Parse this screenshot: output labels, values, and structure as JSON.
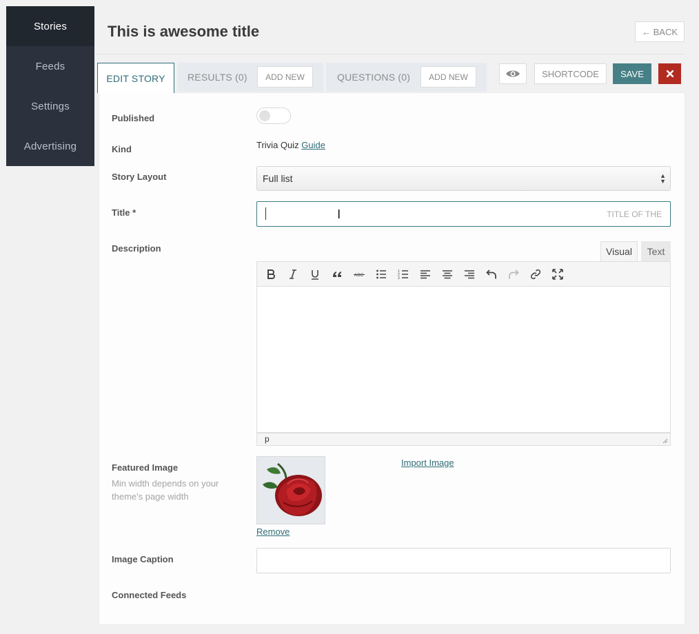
{
  "sidebar": {
    "items": [
      {
        "label": "Stories",
        "active": true
      },
      {
        "label": "Feeds"
      },
      {
        "label": "Settings"
      },
      {
        "label": "Advertising"
      }
    ]
  },
  "header": {
    "title": "This is awesome title",
    "back_label": "← BACK"
  },
  "tabs": {
    "edit_story": "EDIT STORY",
    "results": "RESULTS (0)",
    "results_add": "ADD NEW",
    "questions": "QUESTIONS (0)",
    "questions_add": "ADD NEW"
  },
  "actions": {
    "preview_icon": "eye-icon",
    "shortcode_label": "SHORTCODE",
    "save_label": "SAVE",
    "close_icon": "close-icon",
    "save_color": "#468086",
    "close_color": "#b22b21"
  },
  "form": {
    "published_label": "Published",
    "published_value": false,
    "kind_label": "Kind",
    "kind_value": "Trivia Quiz",
    "kind_link": "Guide",
    "layout_label": "Story Layout",
    "layout_value": "Full list",
    "title_label": "Title *",
    "title_value": "",
    "title_placeholder": "TITLE OF THE",
    "description_label": "Description",
    "editor_tab_visual": "Visual",
    "editor_tab_text": "Text",
    "editor_toolbar": [
      "bold-icon",
      "italic-icon",
      "underline-icon",
      "blockquote-icon",
      "strikethrough-icon",
      "bullet-list-icon",
      "numbered-list-icon",
      "align-left-icon",
      "align-center-icon",
      "align-right-icon",
      "undo-icon",
      "redo-icon",
      "link-icon",
      "fullscreen-icon"
    ],
    "editor_path": "p",
    "featured_label": "Featured Image",
    "featured_hint": "Min width depends on your theme's page width",
    "remove_link": "Remove",
    "import_link": "Import Image",
    "caption_label": "Image Caption",
    "caption_value": "",
    "feeds_label": "Connected Feeds"
  }
}
